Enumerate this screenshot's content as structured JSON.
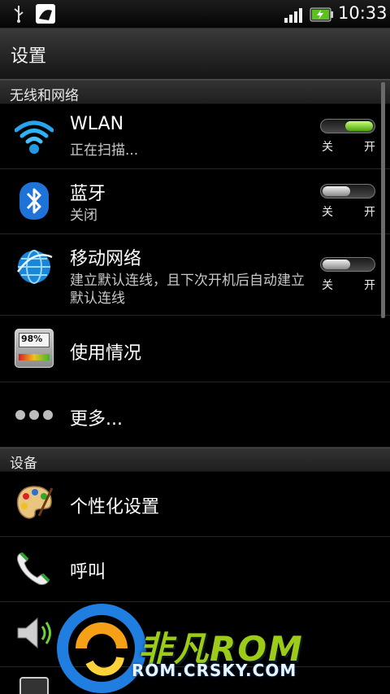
{
  "status_bar": {
    "time": "10:33",
    "icons": [
      "usb-icon",
      "app-notification-icon",
      "signal-icon",
      "battery-charging-icon"
    ]
  },
  "header": {
    "title": "设置"
  },
  "sections": {
    "wireless": "无线和网络",
    "device": "设备"
  },
  "rows": {
    "wlan": {
      "label": "WLAN",
      "sub": "正在扫描...",
      "toggle": "on",
      "icon": "wifi-icon"
    },
    "bluetooth": {
      "label": "蓝牙",
      "sub": "关闭",
      "toggle": "off",
      "icon": "bluetooth-icon"
    },
    "mobile": {
      "label": "移动网络",
      "sub": "建立默认连线，且下次开机后自动建立默认连线",
      "toggle": "off",
      "icon": "globe-icon"
    },
    "usage": {
      "label": "使用情况",
      "icon": "data-usage-icon",
      "badge": "98%"
    },
    "more": {
      "label": "更多...",
      "icon": "more-dots-icon"
    },
    "personalize": {
      "label": "个性化设置",
      "icon": "palette-icon"
    },
    "call": {
      "label": "呼叫",
      "icon": "phone-icon"
    },
    "sound": {
      "label": "",
      "icon": "speaker-icon"
    },
    "display": {
      "label": "",
      "icon": "display-icon"
    }
  },
  "toggle_labels": {
    "off": "关",
    "on": "开"
  },
  "watermark": {
    "title": "非凡ROM",
    "url": "ROM.CRSKY.COM"
  },
  "colors": {
    "toggle_on": "#5fb81a",
    "background": "#000000",
    "watermark_green": "#9ccc18"
  }
}
